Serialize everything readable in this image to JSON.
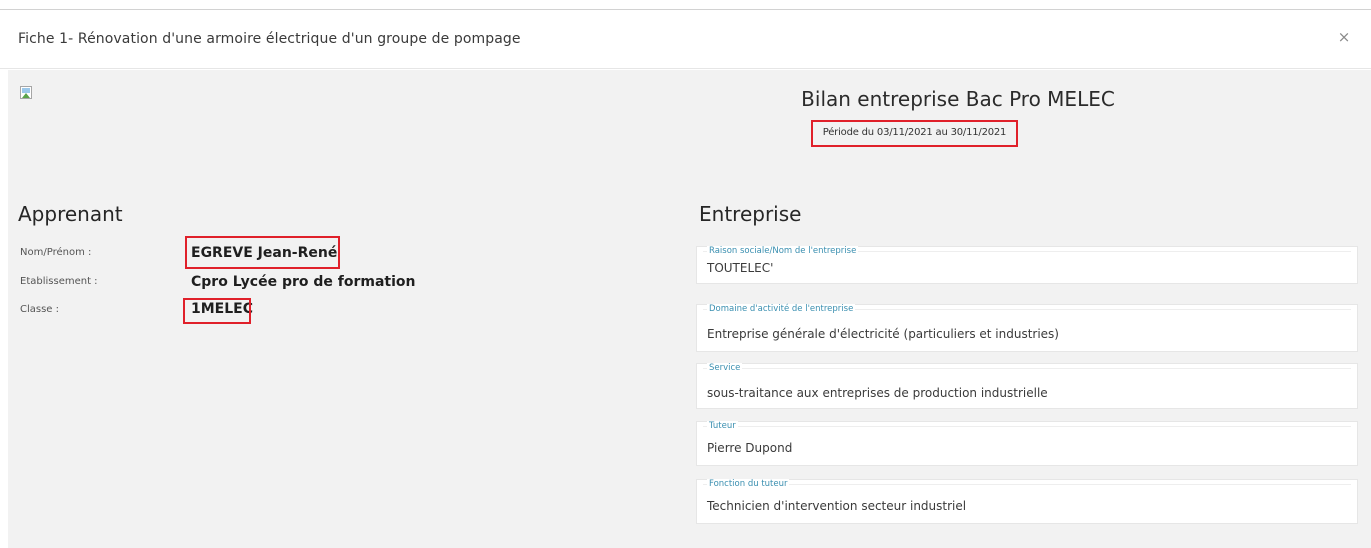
{
  "modal": {
    "title": "Fiche 1- Rénovation d'une armoire électrique d'un groupe de pompage",
    "close_glyph": "×"
  },
  "report": {
    "title": "Bilan entreprise Bac Pro MELEC",
    "period": "Période du 03/11/2021 au 30/11/2021"
  },
  "apprenant": {
    "heading": "Apprenant",
    "rows": [
      {
        "label": "Nom/Prénom :",
        "value": "EGREVE Jean-René"
      },
      {
        "label": "Etablissement :",
        "value": "Cpro Lycée pro de formation"
      },
      {
        "label": "Classe :",
        "value": "1MELEC"
      }
    ]
  },
  "entreprise": {
    "heading": "Entreprise",
    "fields": [
      {
        "label": "Raison sociale/Nom de l'entreprise",
        "value": "TOUTELEC'"
      },
      {
        "label": "Domaine d'activité de l'entreprise",
        "value": "Entreprise générale d'électricité (particuliers et industries)"
      },
      {
        "label": "Service",
        "value": "sous-traitance aux entreprises de production industrielle"
      },
      {
        "label": "Tuteur",
        "value": "Pierre Dupond"
      },
      {
        "label": "Fonction du tuteur",
        "value": "Technicien d'intervention secteur industriel"
      }
    ]
  },
  "icons": {
    "logo_placeholder": "broken-image-icon",
    "close": "close-icon"
  },
  "colors": {
    "highlight": "#e0202a",
    "field_label": "#3a8fb0",
    "body_bg": "#f2f2f2"
  }
}
